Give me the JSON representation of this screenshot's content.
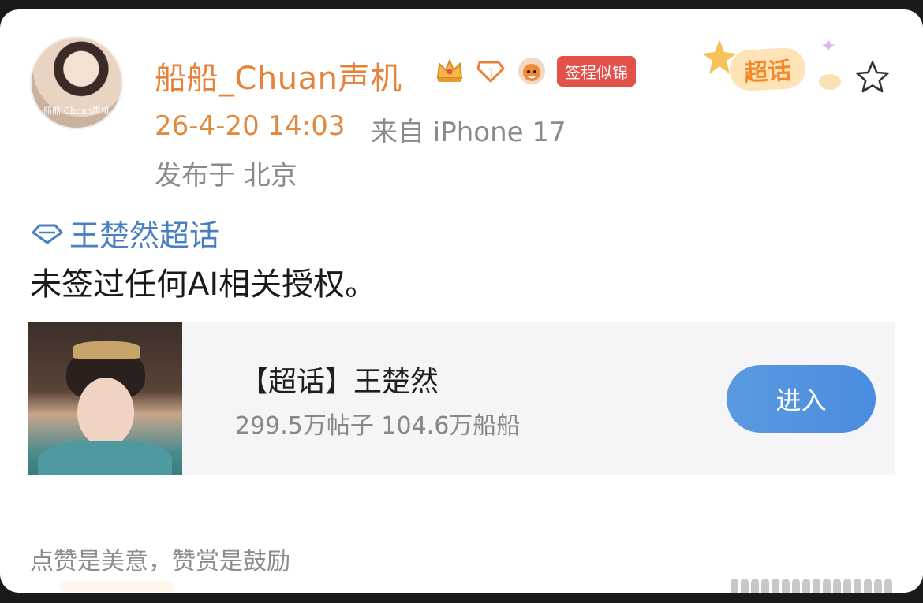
{
  "user": {
    "name": "船船_Chuan声机",
    "avatar_caption": "船船 Chuan声机",
    "sign_badge": "签程似锦"
  },
  "meta": {
    "time": "26-4-20 14:03",
    "source": "来自 iPhone 17",
    "location": "发布于 北京"
  },
  "sticker": {
    "label": "超话"
  },
  "post": {
    "topic": "王楚然超话",
    "text": "未签过任何AI相关授权。"
  },
  "topic_card": {
    "title": "【超话】王楚然",
    "stats": "299.5万帖子 104.6万船船",
    "enter_label": "进入"
  },
  "reward": {
    "text": "点赞是美意，赞赏是鼓励"
  },
  "colors": {
    "username": "#e8823a",
    "time": "#e0893f",
    "topic_link": "#4a7fc2",
    "sign_badge_bg": "#e2524a",
    "enter_button": "#4a8cdf"
  }
}
